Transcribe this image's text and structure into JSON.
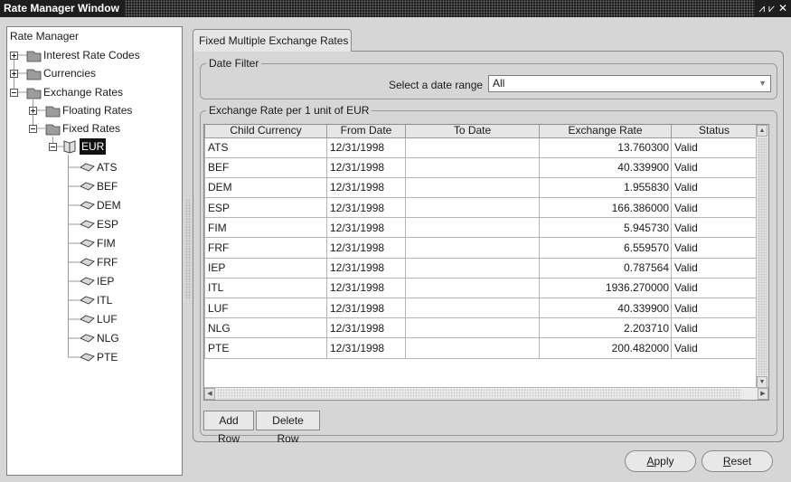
{
  "window": {
    "title": "Rate Manager Window",
    "controls": [
      "⩘",
      "⩗",
      "✕"
    ]
  },
  "tree": {
    "root": "Rate Manager",
    "nodes": [
      {
        "label": "Interest Rate Codes",
        "icon": "folder-stack-icon"
      },
      {
        "label": "Currencies",
        "icon": "folder-stack-icon"
      },
      {
        "label": "Exchange Rates",
        "icon": "folder-stack-icon"
      },
      {
        "label": "Floating Rates",
        "icon": "folder-stack-icon"
      },
      {
        "label": "Fixed Rates",
        "icon": "folder-stack-icon"
      },
      {
        "label": "EUR",
        "icon": "open-book-icon",
        "selected": true
      }
    ],
    "leaves": [
      "ATS",
      "BEF",
      "DEM",
      "ESP",
      "FIM",
      "FRF",
      "IEP",
      "ITL",
      "LUF",
      "NLG",
      "PTE"
    ]
  },
  "tab": {
    "label": "Fixed Multiple Exchange Rates"
  },
  "date_filter": {
    "group_title": "Date Filter",
    "label": "Select a date range",
    "value": "All"
  },
  "rates": {
    "group_title": "Exchange Rate per 1 unit of EUR",
    "columns": [
      "Child Currency",
      "From Date",
      "To Date",
      "Exchange Rate",
      "Status"
    ],
    "rows": [
      [
        "ATS",
        "12/31/1998",
        "",
        "13.760300",
        "Valid"
      ],
      [
        "BEF",
        "12/31/1998",
        "",
        "40.339900",
        "Valid"
      ],
      [
        "DEM",
        "12/31/1998",
        "",
        "1.955830",
        "Valid"
      ],
      [
        "ESP",
        "12/31/1998",
        "",
        "166.386000",
        "Valid"
      ],
      [
        "FIM",
        "12/31/1998",
        "",
        "5.945730",
        "Valid"
      ],
      [
        "FRF",
        "12/31/1998",
        "",
        "6.559570",
        "Valid"
      ],
      [
        "IEP",
        "12/31/1998",
        "",
        "0.787564",
        "Valid"
      ],
      [
        "ITL",
        "12/31/1998",
        "",
        "1936.270000",
        "Valid"
      ],
      [
        "LUF",
        "12/31/1998",
        "",
        "40.339900",
        "Valid"
      ],
      [
        "NLG",
        "12/31/1998",
        "",
        "2.203710",
        "Valid"
      ],
      [
        "PTE",
        "12/31/1998",
        "",
        "200.482000",
        "Valid"
      ]
    ]
  },
  "buttons": {
    "add_row": "Add Row",
    "delete_row": "Delete Row",
    "apply_mnemonic": "A",
    "apply_rest": "pply",
    "reset_mnemonic": "R",
    "reset_rest": "eset"
  }
}
